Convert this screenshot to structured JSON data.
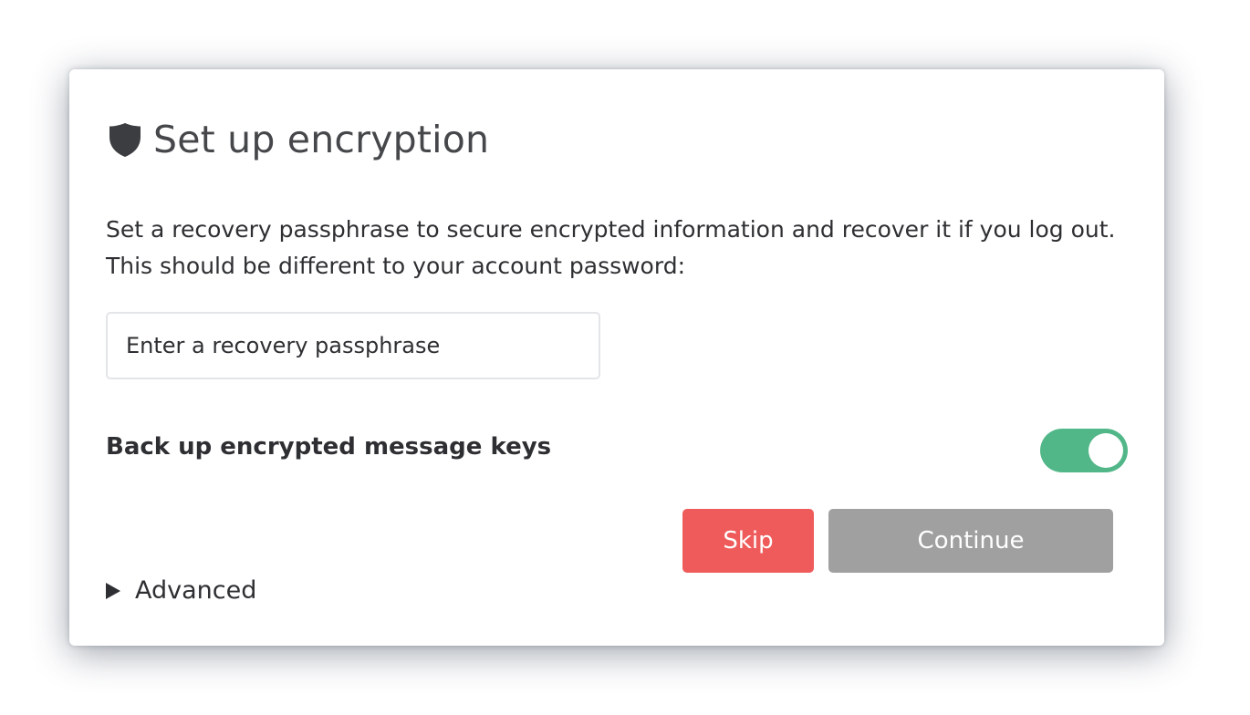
{
  "dialog": {
    "title": "Set up encryption",
    "title_icon": "shield-icon",
    "description": "Set a recovery passphrase to secure encrypted information and recover it if you log out. This should be different to your account password:",
    "passphrase": {
      "placeholder": "Enter a recovery passphrase",
      "value": ""
    },
    "backup": {
      "label": "Back up encrypted message keys",
      "enabled": true
    },
    "buttons": {
      "skip_label": "Skip",
      "continue_label": "Continue"
    },
    "advanced": {
      "label": "Advanced",
      "icon": "triangle-right-icon",
      "expanded": false
    }
  },
  "colors": {
    "toggle_on": "#52b788",
    "skip": "#ef5b5b",
    "continue_disabled": "#a0a0a0",
    "icon": "#3b3d40"
  }
}
